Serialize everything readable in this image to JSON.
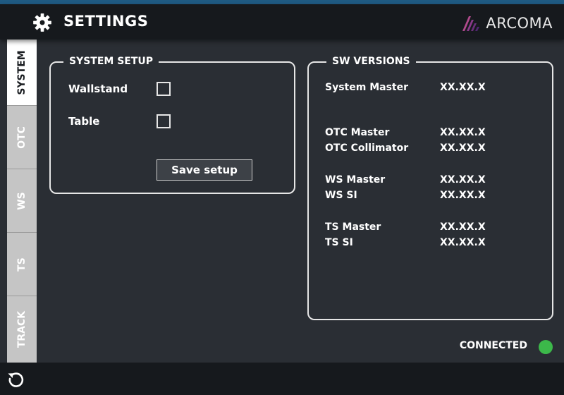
{
  "header": {
    "title": "SETTINGS",
    "title_icon": "gear-icon",
    "brand": "ARCOMA",
    "accent_color": "#1f5a82"
  },
  "sidebar": {
    "tabs": [
      {
        "label": "SYSTEM",
        "active": true
      },
      {
        "label": "OTC",
        "active": false
      },
      {
        "label": "WS",
        "active": false
      },
      {
        "label": "TS",
        "active": false
      },
      {
        "label": "TRACK",
        "active": false
      }
    ]
  },
  "system_setup": {
    "legend": "SYSTEM SETUP",
    "wallstand_label": "Wallstand",
    "wallstand_checked": false,
    "table_label": "Table",
    "table_checked": false,
    "save_label": "Save setup"
  },
  "sw_versions": {
    "legend": "SW VERSIONS",
    "rows": [
      {
        "name": "System Master",
        "value": "XX.XX.X"
      },
      {
        "name": "OTC Master",
        "value": "XX.XX.X"
      },
      {
        "name": "OTC Collimator",
        "value": "XX.XX.X"
      },
      {
        "name": "WS Master",
        "value": "XX.XX.X"
      },
      {
        "name": "WS SI",
        "value": "XX.XX.X"
      },
      {
        "name": "TS Master",
        "value": "XX.XX.X"
      },
      {
        "name": "TS SI",
        "value": "XX.XX.X"
      }
    ]
  },
  "status": {
    "text": "CONNECTED",
    "color": "#3cb84a"
  },
  "footer": {
    "reset_icon": "reset-icon"
  }
}
